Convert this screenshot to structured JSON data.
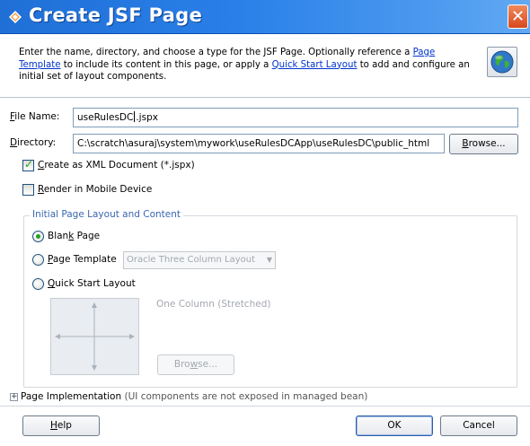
{
  "window": {
    "title": "Create JSF Page",
    "close_glyph": "✕",
    "title_icon": "diamond-icon"
  },
  "header": {
    "desc_part1": "Enter the name, directory, and choose a type for the JSF Page. Optionally reference a ",
    "link1_line1": "Page",
    "link1_line2": "Template",
    "desc_part2": " to include its content in this page, or apply a ",
    "link2": "Quick Start Layout",
    "desc_part3": " to add and configure an initial set of layout components.",
    "icon": "globe-icon"
  },
  "form": {
    "file_name_label_u": "F",
    "file_name_label_rest": "ile Name:",
    "file_name_before_caret": "useRulesDC",
    "file_name_after_caret": ".jspx",
    "directory_label_u": "D",
    "directory_label_rest": "irectory:",
    "directory_value": "C:\\scratch\\asuraj\\system\\mywork\\useRulesDCApp\\useRulesDC\\public_html",
    "browse_u": "B",
    "browse_rest": "rowse...",
    "xml_doc_u": "C",
    "xml_doc_rest": "reate as XML Document (*.jspx)",
    "xml_doc_checked": true,
    "mobile_u": "R",
    "mobile_rest": "ender in Mobile Device",
    "mobile_checked": false
  },
  "layout_group": {
    "title": "Initial Page Layout and Content",
    "blank_before": "Blan",
    "blank_u": "k",
    "blank_after": " Page",
    "page_template_u": "P",
    "page_template_rest": "age Template",
    "template_select_value": "Oracle Three Column Layout",
    "quick_start_u": "Q",
    "quick_start_rest": "uick Start Layout",
    "quick_start_layout_name": "One Column (Stretched)",
    "browse2_before": "Bro",
    "browse2_u": "w",
    "browse2_after": "se...",
    "selected": "blank"
  },
  "page_impl": {
    "expander": "+",
    "label": "Page Implementation",
    "note": " (UI components are not exposed in managed bean)"
  },
  "footer": {
    "help_u": "H",
    "help_rest": "elp",
    "ok": "OK",
    "cancel": "Cancel"
  }
}
